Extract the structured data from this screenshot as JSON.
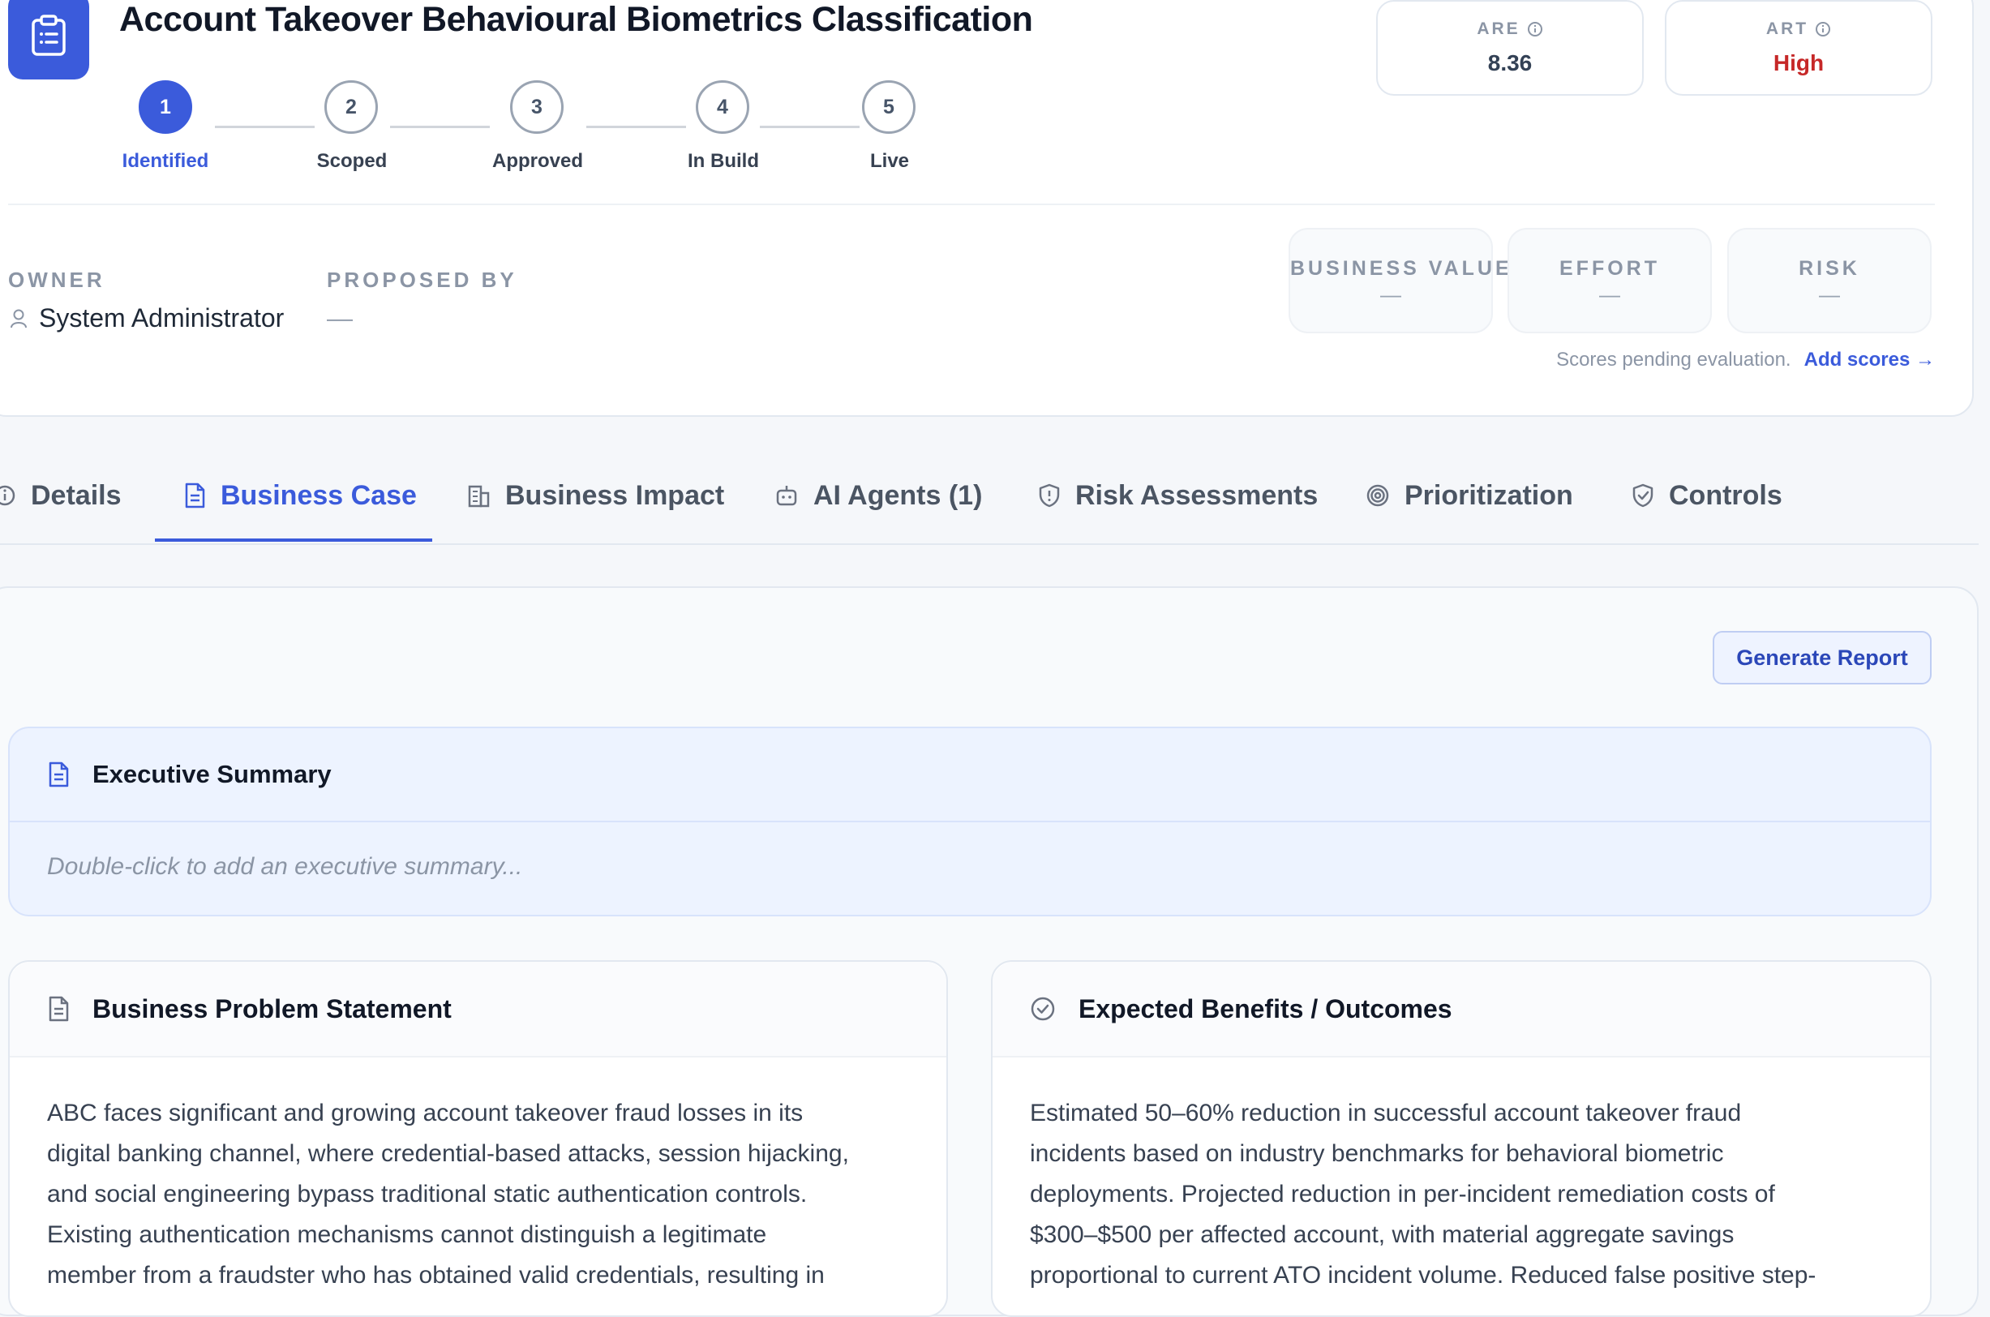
{
  "header": {
    "title": "Account Takeover Behavioural Biometrics Classification",
    "steps": [
      {
        "number": "1",
        "label": "Identified",
        "active": true
      },
      {
        "number": "2",
        "label": "Scoped"
      },
      {
        "number": "3",
        "label": "Approved"
      },
      {
        "number": "4",
        "label": "In Build"
      },
      {
        "number": "5",
        "label": "Live"
      }
    ],
    "scores": {
      "are": {
        "label": "ARE",
        "value": "8.36"
      },
      "art": {
        "label": "ART",
        "value": "High",
        "color": "#c62828"
      }
    },
    "owner": {
      "label": "OWNER",
      "value": "System Administrator"
    },
    "proposed_by": {
      "label": "PROPOSED BY",
      "value": "—"
    },
    "evaluation": {
      "business_value": {
        "label": "BUSINESS VALUE",
        "value": "—"
      },
      "effort": {
        "label": "EFFORT",
        "value": "—"
      },
      "risk": {
        "label": "RISK",
        "value": "—"
      }
    },
    "pending_text": "Scores pending evaluation.",
    "add_scores_label": "Add scores →"
  },
  "tabs": [
    {
      "label": "Details",
      "icon": "info-icon"
    },
    {
      "label": "Business Case",
      "icon": "document-icon",
      "active": true
    },
    {
      "label": "Business Impact",
      "icon": "building-icon"
    },
    {
      "label": "AI Agents (1)",
      "icon": "robot-icon"
    },
    {
      "label": "Risk Assessments",
      "icon": "shield-alert-icon"
    },
    {
      "label": "Prioritization",
      "icon": "target-icon"
    },
    {
      "label": "Controls",
      "icon": "shield-check-icon"
    }
  ],
  "content": {
    "generate_report_label": "Generate Report",
    "executive_summary": {
      "title": "Executive Summary",
      "placeholder": "Double-click to add an executive summary..."
    },
    "problem": {
      "title": "Business Problem Statement",
      "lines": [
        "ABC faces significant and growing account takeover fraud losses in its",
        "digital banking channel, where credential-based attacks, session hijacking,",
        "and social engineering bypass traditional static authentication controls.",
        "Existing authentication mechanisms cannot distinguish a legitimate",
        "member from a fraudster who has obtained valid credentials, resulting in"
      ]
    },
    "benefits": {
      "title": "Expected Benefits / Outcomes",
      "lines": [
        "Estimated 50–60% reduction in successful account takeover fraud",
        "incidents based on industry benchmarks for behavioral biometric",
        "deployments. Projected reduction in per-incident remediation costs of",
        "$300–$500 per affected account, with material aggregate savings",
        "proportional to current ATO incident volume. Reduced false positive step-"
      ]
    }
  },
  "colors": {
    "accent": "#3b5bdb",
    "high": "#c62828"
  }
}
